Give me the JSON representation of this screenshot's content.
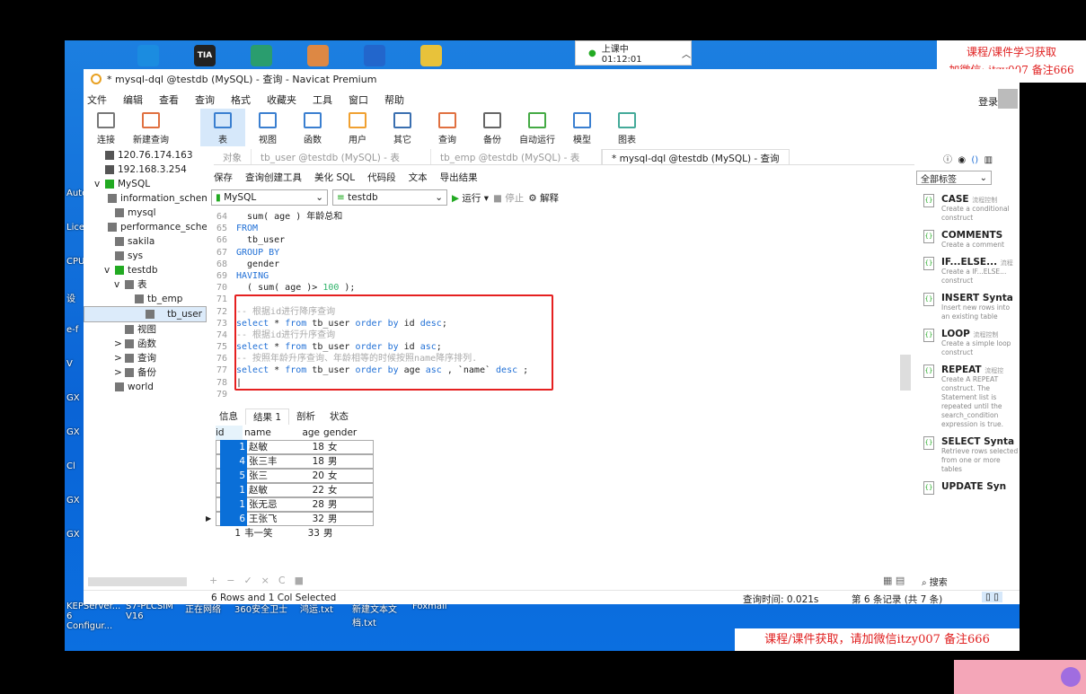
{
  "desktop": {
    "top_icons": [
      "edge",
      "TIA",
      "app3",
      "app4",
      "K",
      "folder"
    ],
    "left_labels": [
      "Auto",
      "Lice",
      "CPU",
      "设",
      "e-f",
      "V",
      "GX",
      "GX",
      "Cl",
      "GX",
      "GX"
    ],
    "bottom_labels": [
      "KEPServer... 6 Configur...",
      "S7-PLCSIM V16",
      "正在网络",
      "360安全卫士",
      "鸿运.txt",
      "新建文本文档.txt",
      "Foxmail"
    ]
  },
  "clock": {
    "label": "上课中 01:12:01"
  },
  "watermark": {
    "top_line1": "课程/课件学习获取",
    "top_line2": "加微信: itzy007 备注666",
    "bottom": "课程/课件获取，请加微信itzy007 备注666"
  },
  "window": {
    "title": "* mysql-dql @testdb (MySQL) - 查询 - Navicat Premium",
    "login": "登录"
  },
  "menu": [
    "文件",
    "编辑",
    "查看",
    "查询",
    "格式",
    "收藏夹",
    "工具",
    "窗口",
    "帮助"
  ],
  "toolbar": [
    {
      "label": "连接",
      "icon": "plug-icon"
    },
    {
      "label": "新建查询",
      "icon": "new-query-icon"
    },
    {
      "label": "表",
      "icon": "table-icon",
      "active": true
    },
    {
      "label": "视图",
      "icon": "view-icon"
    },
    {
      "label": "函数",
      "icon": "function-icon"
    },
    {
      "label": "用户",
      "icon": "user-icon"
    },
    {
      "label": "其它",
      "icon": "tools-icon"
    },
    {
      "label": "查询",
      "icon": "query-icon"
    },
    {
      "label": "备份",
      "icon": "backup-icon"
    },
    {
      "label": "自动运行",
      "icon": "schedule-icon"
    },
    {
      "label": "模型",
      "icon": "model-icon"
    },
    {
      "label": "图表",
      "icon": "chart-icon"
    }
  ],
  "tree": [
    {
      "label": "120.76.174.163",
      "lvl": 0
    },
    {
      "label": "192.168.3.254",
      "lvl": 0
    },
    {
      "label": "MySQL",
      "lvl": 0,
      "exp": "v"
    },
    {
      "label": "information_schema",
      "lvl": 1
    },
    {
      "label": "mysql",
      "lvl": 1
    },
    {
      "label": "performance_schema",
      "lvl": 1
    },
    {
      "label": "sakila",
      "lvl": 1
    },
    {
      "label": "sys",
      "lvl": 1
    },
    {
      "label": "testdb",
      "lvl": 1,
      "exp": "v"
    },
    {
      "label": "表",
      "lvl": 2,
      "exp": "v"
    },
    {
      "label": "tb_emp",
      "lvl": 3
    },
    {
      "label": "tb_user",
      "lvl": 3,
      "sel": true
    },
    {
      "label": "视图",
      "lvl": 2
    },
    {
      "label": "函数",
      "lvl": 2,
      "exp": ">"
    },
    {
      "label": "查询",
      "lvl": 2,
      "exp": ">"
    },
    {
      "label": "备份",
      "lvl": 2,
      "exp": ">"
    },
    {
      "label": "world",
      "lvl": 1
    }
  ],
  "tabs": [
    "对象",
    "tb_user @testdb (MySQL) - 表",
    "tb_emp @testdb (MySQL) - 表",
    "* mysql-dql @testdb (MySQL) - 查询"
  ],
  "query_toolbar": [
    "保存",
    "查询创建工具",
    "美化 SQL",
    "代码段",
    "文本",
    "导出结果"
  ],
  "connection": "MySQL",
  "database": "testdb",
  "run": "运行",
  "stop": "停止",
  "explain": "解释",
  "code": [
    {
      "n": "64",
      "t": [
        [
          "",
          "  sum( age ) 年龄总和"
        ]
      ]
    },
    {
      "n": "65",
      "t": [
        [
          "kw",
          "FROM"
        ]
      ]
    },
    {
      "n": "66",
      "t": [
        [
          "",
          "  tb_user"
        ]
      ]
    },
    {
      "n": "67",
      "t": [
        [
          "kw",
          "GROUP BY"
        ]
      ]
    },
    {
      "n": "68",
      "t": [
        [
          "",
          "  gender"
        ]
      ]
    },
    {
      "n": "69",
      "t": [
        [
          "kw",
          "HAVING"
        ]
      ]
    },
    {
      "n": "70",
      "t": [
        [
          "",
          "  ( sum( age )> "
        ],
        [
          "num",
          "100"
        ],
        [
          "",
          " );"
        ]
      ]
    },
    {
      "n": "71",
      "t": []
    },
    {
      "n": "72",
      "t": [
        [
          "cm",
          "-- 根据id进行降序查询"
        ]
      ]
    },
    {
      "n": "73",
      "t": [
        [
          "kw",
          "select"
        ],
        [
          "",
          " * "
        ],
        [
          "kw",
          "from"
        ],
        [
          "",
          " tb_user "
        ],
        [
          "kw",
          "order by"
        ],
        [
          "",
          " id "
        ],
        [
          "kw",
          "desc"
        ],
        [
          "",
          ";"
        ]
      ]
    },
    {
      "n": "74",
      "t": [
        [
          "cm",
          "-- 根据id进行升序查询"
        ]
      ]
    },
    {
      "n": "75",
      "t": [
        [
          "kw",
          "select"
        ],
        [
          "",
          " * "
        ],
        [
          "kw",
          "from"
        ],
        [
          "",
          " tb_user "
        ],
        [
          "kw",
          "order by"
        ],
        [
          "",
          " id "
        ],
        [
          "kw",
          "asc"
        ],
        [
          "",
          ";"
        ]
      ]
    },
    {
      "n": "76",
      "t": [
        [
          "cm",
          "-- 按照年龄升序查询、年龄相等的时候按照name降序排列."
        ]
      ]
    },
    {
      "n": "77",
      "t": [
        [
          "kw",
          "select"
        ],
        [
          "",
          " * "
        ],
        [
          "kw",
          "from"
        ],
        [
          "",
          " tb_user "
        ],
        [
          "kw",
          "order by"
        ],
        [
          "",
          " age "
        ],
        [
          "kw",
          "asc"
        ],
        [
          "",
          " , `name` "
        ],
        [
          "kw",
          "desc"
        ],
        [
          "",
          " ;"
        ]
      ]
    },
    {
      "n": "78",
      "t": [
        [
          "",
          "|"
        ]
      ]
    },
    {
      "n": "79",
      "t": []
    }
  ],
  "result_tabs": [
    "信息",
    "结果 1",
    "剖析",
    "状态"
  ],
  "grid": {
    "columns": [
      "id",
      "name",
      "age",
      "gender"
    ],
    "rows": [
      [
        "1",
        "赵敏",
        "18",
        "女"
      ],
      [
        "4",
        "张三丰",
        "18",
        "男"
      ],
      [
        "5",
        "张三",
        "20",
        "女"
      ],
      [
        "1",
        "赵敏",
        "22",
        "女"
      ],
      [
        "1",
        "张无忌",
        "28",
        "男"
      ],
      [
        "6",
        "王张飞",
        "32",
        "男"
      ],
      [
        "1",
        "韦一笑",
        "33",
        "男"
      ]
    ],
    "selected_rows": 6,
    "current_row": 6
  },
  "grid_buttons": [
    "+",
    "−",
    "✓",
    "×",
    "C",
    "■"
  ],
  "status": {
    "selection": "6 Rows and 1 Col Selected",
    "query_time": "查询时间: 0.021s",
    "record": "第 6 条记录 (共 7 条)"
  },
  "right_panel": {
    "filter": "全部标签",
    "search": "搜索",
    "snippets": [
      {
        "title": "CASE",
        "tag": "流程控制",
        "desc": "Create a conditional construct"
      },
      {
        "title": "COMMENTS",
        "tag": "",
        "desc": "Create a comment"
      },
      {
        "title": "IF...ELSE...",
        "tag": "流程",
        "desc": "Create a IF...ELSE... construct"
      },
      {
        "title": "INSERT Synta",
        "tag": "",
        "desc": "Insert new rows into an existing table"
      },
      {
        "title": "LOOP",
        "tag": "流程控制",
        "desc": "Create a simple loop construct"
      },
      {
        "title": "REPEAT",
        "tag": "流程控",
        "desc": "Create A REPEAT construct. The Statement list is repeated until the search_condition expression is true."
      },
      {
        "title": "SELECT Synta",
        "tag": "",
        "desc": "Retrieve rows selected from one or more tables"
      },
      {
        "title": "UPDATE Syn",
        "tag": "",
        "desc": ""
      }
    ]
  },
  "colors": {
    "accent": "#0a6fd8",
    "highlight": "#e52020",
    "keyword": "#1f6fd6",
    "desktop": "#0a64d6"
  }
}
